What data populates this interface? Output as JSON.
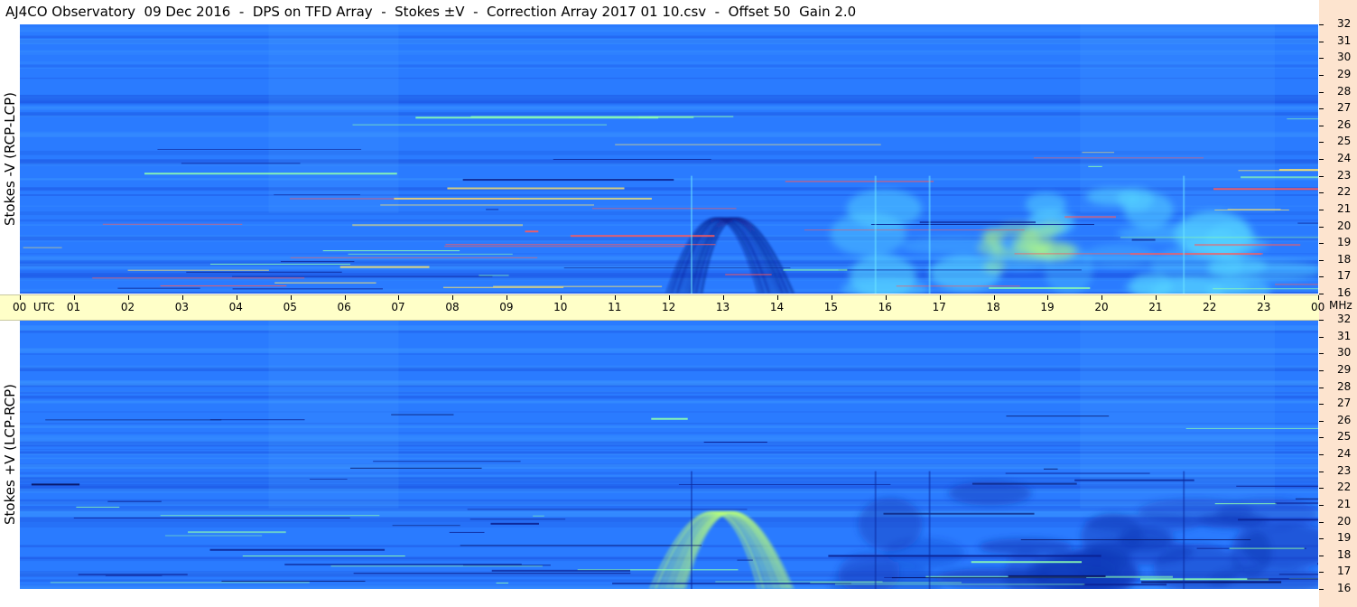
{
  "title": "AJ4CO Observatory  09 Dec 2016  -  DPS on TFD Array  -  Stokes ±V  -  Correction Array 2017 01 10.csv  -  Offset 50  Gain 2.0",
  "colors": {
    "background_blue": "#2a7bff",
    "burst_dark": "#0a1f8f",
    "burst_bright": "#b9ff7a",
    "time_axis_bg": "#ffffc8",
    "freq_axis_bg": "#fde4cf"
  },
  "chart_data": [
    {
      "type": "heatmap",
      "panel": "top",
      "ylabel": "Stokes -V (RCP-LCP)",
      "x": {
        "label": "UTC",
        "range": [
          0,
          24
        ],
        "unit": "hour"
      },
      "y": {
        "label": "MHz",
        "range": [
          16,
          32
        ],
        "unit": "MHz"
      },
      "features": [
        {
          "kind": "burst",
          "start": 12.3,
          "end": 14.0,
          "peak": 13.0,
          "freq_low": 16,
          "freq_high": 22.8,
          "polarity": "dark"
        },
        {
          "kind": "emission",
          "start": 15.5,
          "end": 23.5,
          "freq_low": 16,
          "freq_high": 22,
          "polarity": "bright"
        }
      ]
    },
    {
      "type": "heatmap",
      "panel": "bottom",
      "ylabel": "Stokes +V (LCP-RCP)",
      "x": {
        "label": "UTC",
        "range": [
          0,
          24
        ],
        "unit": "hour"
      },
      "y": {
        "label": "MHz",
        "range": [
          16,
          32
        ],
        "unit": "MHz"
      },
      "features": [
        {
          "kind": "burst",
          "start": 12.0,
          "end": 14.0,
          "peak": 13.0,
          "freq_low": 16,
          "freq_high": 23,
          "polarity": "bright"
        },
        {
          "kind": "absorption",
          "start": 15.5,
          "end": 23.5,
          "freq_low": 16,
          "freq_high": 22,
          "polarity": "dark"
        }
      ]
    }
  ],
  "time_axis": {
    "ticks": [
      "00  UTC",
      "01",
      "02",
      "03",
      "04",
      "05",
      "06",
      "07",
      "08",
      "09",
      "10",
      "11",
      "12",
      "13",
      "14",
      "15",
      "16",
      "17",
      "18",
      "19",
      "20",
      "21",
      "22",
      "23",
      "00"
    ],
    "unit": "MHz"
  },
  "freq_axis": {
    "ticks": [
      "32",
      "31",
      "30",
      "29",
      "28",
      "27",
      "26",
      "25",
      "24",
      "23",
      "22",
      "21",
      "20",
      "19",
      "18",
      "17",
      "16"
    ]
  }
}
